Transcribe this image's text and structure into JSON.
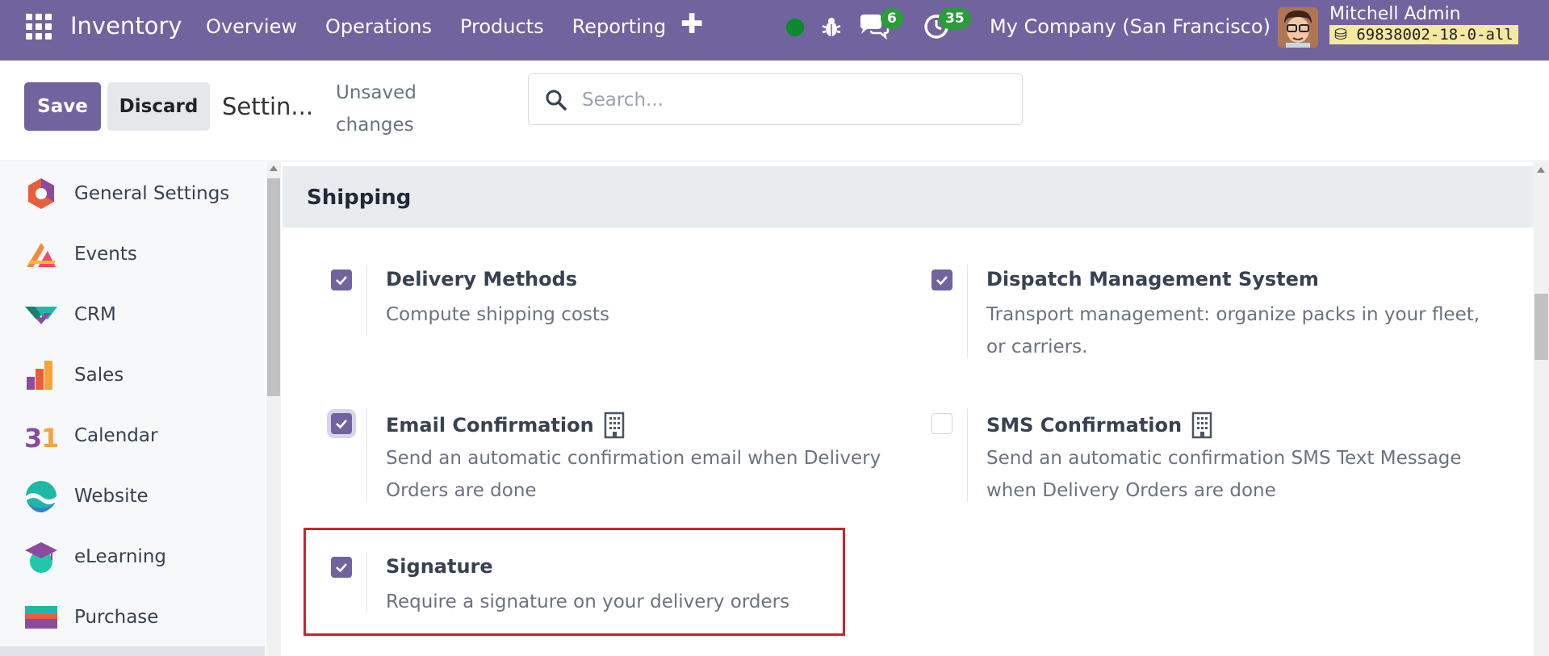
{
  "navbar": {
    "app_name": "Inventory",
    "menu": [
      "Overview",
      "Operations",
      "Products",
      "Reporting"
    ],
    "messages_count": "6",
    "activities_count": "35",
    "company": "My Company (San Francisco)",
    "user_name": "Mitchell Admin",
    "database": "69838002-18-0-all",
    "status_color": "#0a8a2a",
    "brand_color": "#71639e"
  },
  "control": {
    "save_label": "Save",
    "discard_label": "Discard",
    "breadcrumb": "Settin...",
    "unsaved": "Unsaved changes",
    "search_placeholder": "Search..."
  },
  "sidebar": {
    "items": [
      {
        "label": "General Settings",
        "icon": "general-settings-icon"
      },
      {
        "label": "Events",
        "icon": "events-icon"
      },
      {
        "label": "CRM",
        "icon": "crm-icon"
      },
      {
        "label": "Sales",
        "icon": "sales-icon"
      },
      {
        "label": "Calendar",
        "icon": "calendar-icon"
      },
      {
        "label": "Website",
        "icon": "website-icon"
      },
      {
        "label": "eLearning",
        "icon": "elearning-icon"
      },
      {
        "label": "Purchase",
        "icon": "purchase-icon"
      }
    ]
  },
  "section": {
    "title": "Shipping",
    "settings": [
      {
        "title": "Delivery Methods",
        "desc": "Compute shipping costs",
        "checked": true
      },
      {
        "title": "Dispatch Management System",
        "desc": "Transport management: organize packs in your fleet, or carriers.",
        "checked": true
      },
      {
        "title": "Email Confirmation",
        "desc": "Send an automatic confirmation email when Delivery Orders are done",
        "checked": true
      },
      {
        "title": "SMS Confirmation",
        "desc": "Send an automatic confirmation SMS Text Message when Delivery Orders are done",
        "checked": false
      },
      {
        "title": "Signature",
        "desc": "Require a signature on your delivery orders",
        "checked": true
      }
    ]
  },
  "highlight_color": "#d0202e"
}
